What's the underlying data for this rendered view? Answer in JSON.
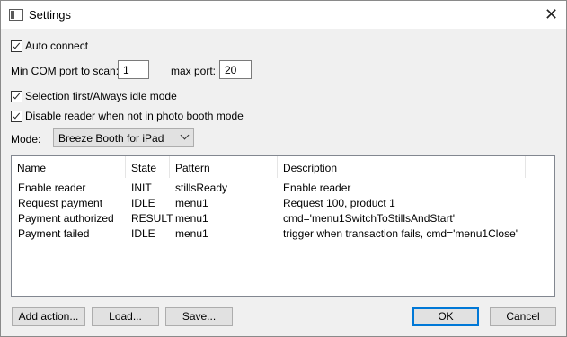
{
  "window": {
    "title": "Settings"
  },
  "options": {
    "auto_connect": {
      "label": "Auto connect",
      "checked": true
    },
    "min_com_label": "Min COM port to scan:",
    "min_com_value": "1",
    "max_port_label": "max port:",
    "max_port_value": "20",
    "selection_first": {
      "label": "Selection first/Always idle mode",
      "checked": true
    },
    "disable_reader": {
      "label": "Disable reader when not in photo booth mode",
      "checked": true
    },
    "mode_label": "Mode:",
    "mode_value": "Breeze Booth for iPad"
  },
  "table": {
    "columns": [
      "Name",
      "State",
      "Pattern",
      "Description"
    ],
    "rows": [
      [
        "Enable reader",
        "INIT",
        "stillsReady",
        "Enable reader"
      ],
      [
        "Request payment",
        "IDLE",
        "menu1",
        "Request 100, product 1"
      ],
      [
        "Payment authorized",
        "RESULT",
        "menu1",
        "cmd='menu1SwitchToStillsAndStart'"
      ],
      [
        "Payment failed",
        "IDLE",
        "menu1",
        "trigger when transaction fails, cmd='menu1Close'"
      ]
    ]
  },
  "buttons": {
    "add_action": "Add action...",
    "load": "Load...",
    "save": "Save...",
    "ok": "OK",
    "cancel": "Cancel"
  },
  "icons": {
    "app": "window-icon",
    "close": "close-icon"
  }
}
